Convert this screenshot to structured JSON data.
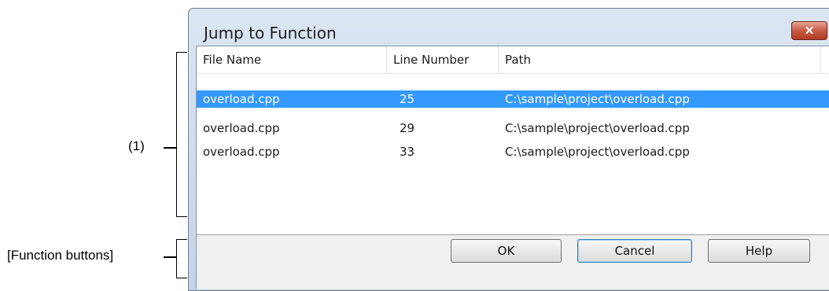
{
  "annotations": {
    "list_label": "(1)",
    "buttons_label": "[Function buttons]"
  },
  "dialog": {
    "title": "Jump to Function",
    "close_glyph": "✕"
  },
  "list": {
    "columns": [
      "File Name",
      "Line Number",
      "Path"
    ],
    "rows": [
      {
        "file": "overload.cpp",
        "line": "25",
        "path": "C:\\sample\\project\\overload.cpp",
        "selected": true
      },
      {
        "file": "overload.cpp",
        "line": "29",
        "path": "C:\\sample\\project\\overload.cpp",
        "selected": false
      },
      {
        "file": "overload.cpp",
        "line": "33",
        "path": "C:\\sample\\project\\overload.cpp",
        "selected": false
      }
    ]
  },
  "buttons": {
    "ok": "OK",
    "cancel": "Cancel",
    "help": "Help"
  },
  "colors": {
    "selection": "#3399ff",
    "close_button": "#c75a45"
  }
}
